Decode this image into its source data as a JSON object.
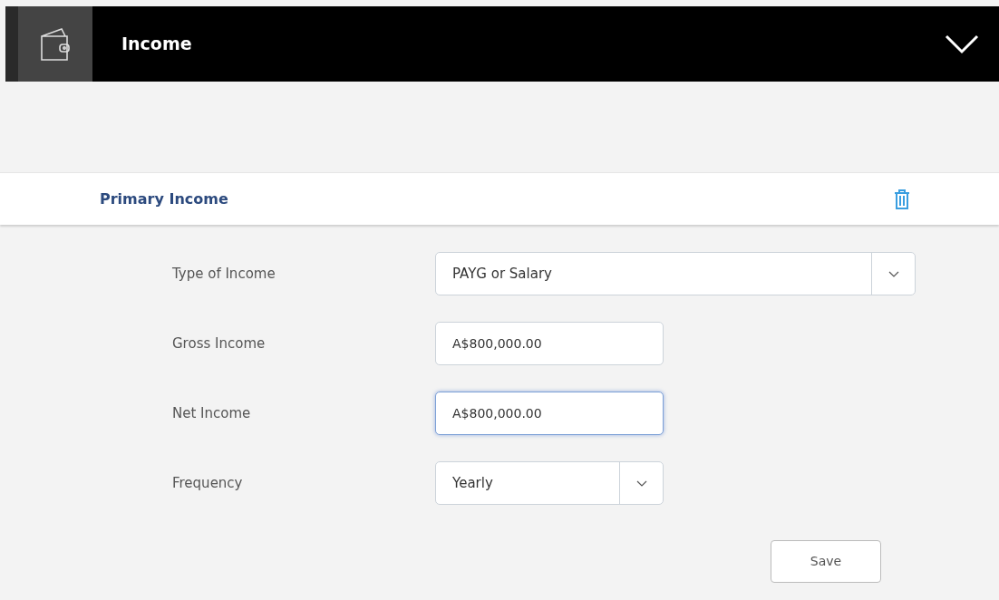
{
  "header": {
    "title": "Income"
  },
  "section": {
    "title": "Primary Income"
  },
  "fields": [
    {
      "label": "Type of Income",
      "kind": "select",
      "value": "PAYG or Salary",
      "full_width": true,
      "focused": false
    },
    {
      "label": "Gross Income",
      "kind": "text",
      "value": "A$800,000.00",
      "full_width": false,
      "focused": false
    },
    {
      "label": "Net Income",
      "kind": "text",
      "value": "A$800,000.00",
      "full_width": false,
      "focused": true
    },
    {
      "label": "Frequency",
      "kind": "select",
      "value": "Yearly",
      "full_width": false,
      "focused": false
    }
  ],
  "buttons": [
    {
      "label": "Save"
    }
  ]
}
